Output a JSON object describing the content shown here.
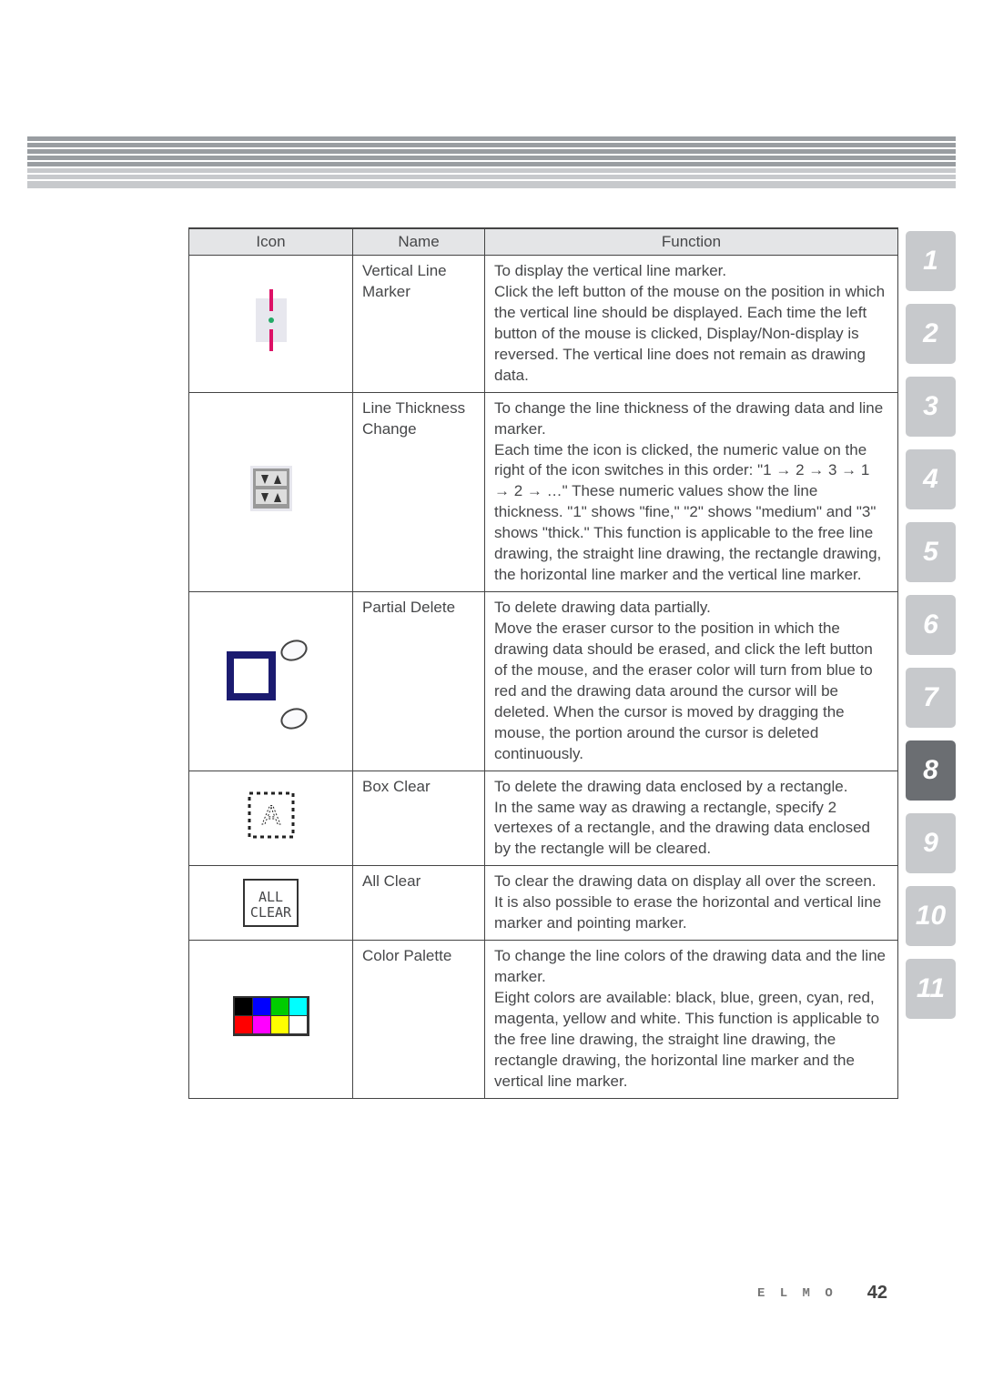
{
  "header": {
    "icon": "Icon",
    "name": "Name",
    "function": "Function"
  },
  "rows": [
    {
      "name": "Vertical Line Marker",
      "func": "To display the vertical line marker.\nClick the left button of the mouse on the position in which the vertical line should be displayed. Each time the left button of the mouse is clicked, Display/Non-display is reversed. The vertical line does not remain as drawing data."
    },
    {
      "name": "Line Thickness Change",
      "func": "To change the line thickness of the drawing data and line marker.\nEach time the icon is clicked, the numeric value on the right of the icon switches in this order: \"1 → 2 → 3 → 1 → 2 → …\" These numeric values show the line thickness. \"1\" shows \"fine,\" \"2\" shows \"medium\" and \"3\" shows \"thick.\" This function is applicable to the free line drawing, the straight line drawing, the rectangle drawing, the horizontal line marker and the vertical line marker."
    },
    {
      "name": "Partial Delete",
      "func": "To delete drawing data partially.\nMove the eraser cursor to the position in which the drawing data should be erased, and click the left button of the mouse, and the eraser color will turn from blue to red and the drawing data around the cursor will be deleted. When the cursor is moved by dragging the mouse, the portion around the cursor is deleted continuously."
    },
    {
      "name": "Box Clear",
      "func": "To delete the drawing data enclosed by a rectangle.\nIn the same way as drawing a rectangle, specify 2 vertexes of a rectangle, and the drawing data enclosed by the rectangle will be cleared."
    },
    {
      "name": "All Clear",
      "func": "To clear the drawing data on display all over the screen.\nIt is also possible to erase the horizontal and vertical line marker and pointing marker."
    },
    {
      "name": "Color Palette",
      "func": "To change the line colors of the drawing data and the line marker.\nEight colors are available: black, blue, green, cyan, red, magenta, yellow and white. This function is applicable to the free line drawing, the straight line drawing, the rectangle drawing, the horizontal line marker and the vertical line marker."
    }
  ],
  "allclear": {
    "line1": "ALL",
    "line2": "CLEAR"
  },
  "tabs": [
    "1",
    "2",
    "3",
    "4",
    "5",
    "6",
    "7",
    "8",
    "9",
    "10",
    "11"
  ],
  "activeTab": "8",
  "footer": {
    "brand": "E L M O",
    "page": "42"
  }
}
